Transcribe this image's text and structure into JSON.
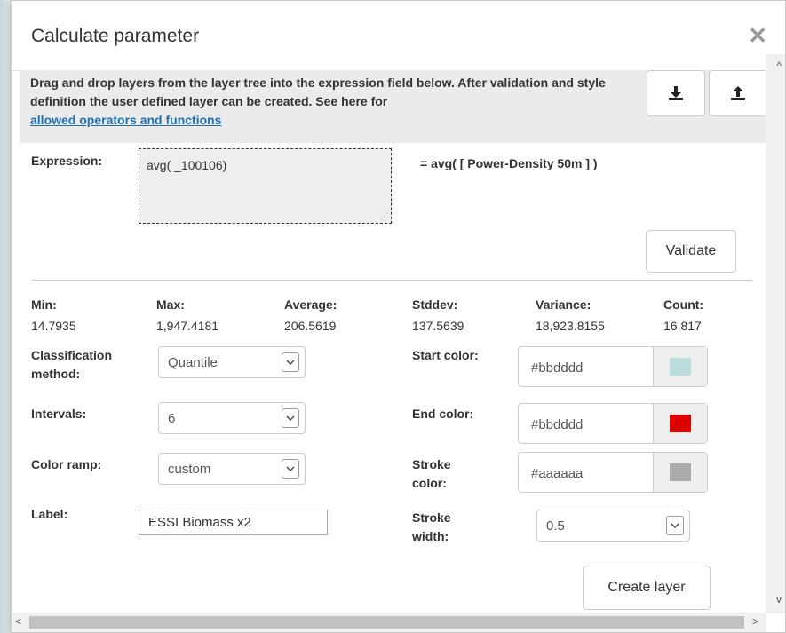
{
  "dialog": {
    "title": "Calculate parameter",
    "close_glyph": "✕"
  },
  "info": {
    "text": "Drag and drop layers from the layer tree into the expression field below. After validation and style definition the user defined layer can be created. See here for",
    "link": "allowed operators and functions",
    "download_icon": "download-icon",
    "upload_icon": "upload-icon"
  },
  "expression": {
    "label": "Expression:",
    "value": "avg( _100106)",
    "result": "= avg( [ Power-Density 50m ] )",
    "validate_label": "Validate"
  },
  "stats": [
    {
      "label": "Min:",
      "value": "14.7935"
    },
    {
      "label": "Max:",
      "value": "1,947.4181"
    },
    {
      "label": "Average:",
      "value": "206.5619"
    },
    {
      "label": "Stddev:",
      "value": "137.5639"
    },
    {
      "label": "Variance:",
      "value": "18,923.8155"
    },
    {
      "label": "Count:",
      "value": "16,817"
    }
  ],
  "form": {
    "classification_label_1": "Classification",
    "classification_label_2": "method:",
    "classification_value": "Quantile",
    "intervals_label": "Intervals:",
    "intervals_value": "6",
    "color_ramp_label": "Color ramp:",
    "color_ramp_value": "custom",
    "label_label": "Label:",
    "label_value": "ESSI Biomass x2",
    "start_color_label": "Start color:",
    "start_color_value": "#bbdddd",
    "start_color_swatch": "#bbdddd",
    "end_color_label": "End color:",
    "end_color_value": "#bbdddd",
    "end_color_swatch": "#dd0000",
    "stroke_color_label_1": "Stroke",
    "stroke_color_label_2": "color:",
    "stroke_color_value": "#aaaaaa",
    "stroke_color_swatch": "#aaaaaa",
    "stroke_width_label_1": "Stroke",
    "stroke_width_label_2": "width:",
    "stroke_width_value": "0.5"
  },
  "actions": {
    "create_label": "Create layer"
  },
  "scroll": {
    "up": "^",
    "down": "v",
    "left": "<",
    "right": ">"
  }
}
